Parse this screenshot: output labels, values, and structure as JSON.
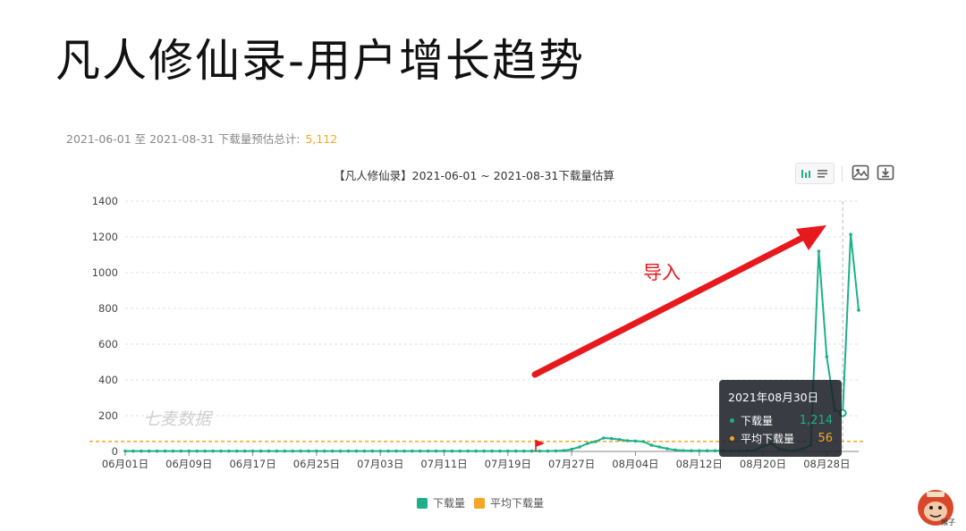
{
  "page": {
    "title": "凡人修仙录-用户增长趋势",
    "summary_label": "2021-06-01 至 2021-08-31 下载量预估总计:",
    "summary_total": "5,112",
    "chart_title": "【凡人修仙录】2021-06-01 ~ 2021-08-31下载量估算",
    "watermark": "七麦数据",
    "annotation": "导入",
    "logo_caption": "猴子"
  },
  "toolbar": {
    "items": [
      "chart-type-icon",
      "list-view-icon",
      "image-icon",
      "download-icon"
    ]
  },
  "tooltip": {
    "date": "2021年08月30日",
    "rows": [
      {
        "label": "下载量",
        "value": "1,214"
      },
      {
        "label": "平均下载量",
        "value": "56"
      }
    ]
  },
  "chart_data": {
    "type": "line",
    "title": "【凡人修仙录】2021-06-01 ~ 2021-08-31下载量估算",
    "xlabel": "",
    "ylabel": "",
    "ylim": [
      0,
      1400
    ],
    "yticks": [
      0,
      200,
      400,
      600,
      800,
      1000,
      1200,
      1400
    ],
    "xticks": [
      "06月01日",
      "06月09日",
      "06月17日",
      "06月25日",
      "07月03日",
      "07月11日",
      "07月19日",
      "07月27日",
      "08月04日",
      "08月12日",
      "08月20日",
      "08月28日"
    ],
    "grid": true,
    "legend_position": "bottom",
    "x_start": "2021-06-01",
    "series": [
      {
        "name": "下载量",
        "color": "#1eb08a",
        "values": [
          2,
          2,
          2,
          2,
          2,
          2,
          2,
          2,
          2,
          2,
          2,
          2,
          2,
          2,
          2,
          2,
          2,
          2,
          2,
          2,
          2,
          2,
          2,
          2,
          2,
          2,
          2,
          2,
          2,
          2,
          2,
          2,
          2,
          2,
          2,
          2,
          2,
          2,
          2,
          2,
          2,
          2,
          2,
          2,
          2,
          2,
          2,
          2,
          2,
          2,
          2,
          2,
          2,
          2,
          3,
          5,
          12,
          25,
          45,
          55,
          75,
          72,
          66,
          60,
          58,
          55,
          35,
          25,
          15,
          8,
          5,
          4,
          4,
          4,
          4,
          4,
          3,
          3,
          4,
          5,
          30,
          45,
          15,
          5,
          5,
          15,
          35,
          1120,
          530,
          230,
          215,
          1214,
          790
        ]
      },
      {
        "name": "平均下载量",
        "color": "#f5a623",
        "values": [
          56
        ]
      }
    ],
    "tooltip_marker_date": "08月30日"
  }
}
